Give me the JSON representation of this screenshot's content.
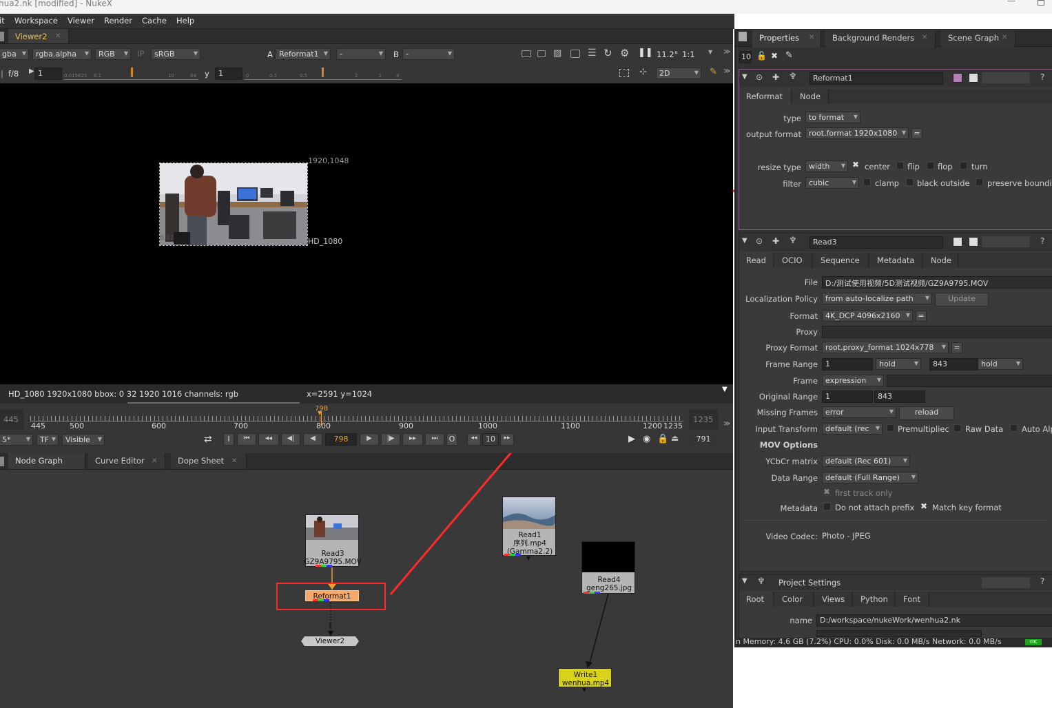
{
  "titlebar": {
    "title": "hua2.nk [modified] - NukeX"
  },
  "menu": {
    "items": [
      "it",
      "Workspace",
      "Viewer",
      "Render",
      "Cache",
      "Help"
    ]
  },
  "viewer": {
    "tab": "Viewer2",
    "channels": "gba",
    "channel_alpha": "rgba.alpha",
    "color": "RGB",
    "ip": "IP",
    "lut": "sRGB",
    "input_a_label": "A",
    "input_a": "Reformat1",
    "input_a2": "-",
    "input_b_label": "B",
    "input_b": "-",
    "zoom": "11.2°",
    "ratio": "1:1",
    "fstop": "f/8",
    "gain": "1",
    "gamma_label": "y",
    "gamma": "1",
    "view_mode": "2D",
    "gain_ticks": [
      "0.015625",
      "0.1",
      "1",
      "10",
      "64"
    ],
    "gamma_ticks": [
      "0",
      "0.1",
      "0.5",
      "1",
      "2",
      "3",
      "4"
    ],
    "image_coord": "1920,1048",
    "format_name": "HD_1080",
    "bottom_left_coord": "0,32",
    "info": "HD_1080 1920x1080  bbox: 0 32 1920 1016 channels: rgb",
    "coords": "x=2591 y=1024"
  },
  "timeline": {
    "start": "445",
    "end": "1235",
    "current": "798",
    "ticks": [
      "445",
      "500",
      "600",
      "700",
      "800",
      "900",
      "1000",
      "1100",
      "1200",
      "1235"
    ],
    "fps": "5*",
    "tf": "TF",
    "visible": "Visible",
    "frame_field": "798",
    "step": "10",
    "end_field": "791",
    "in_label": "I",
    "out_label": "O"
  },
  "nodegraph": {
    "tabs": [
      "Node Graph",
      "Curve Editor",
      "Dope Sheet"
    ],
    "nodes": {
      "read3": {
        "name": "Read3",
        "file": "GZ9A9795.MOV"
      },
      "reformat": {
        "name": "Reformat1"
      },
      "viewer": {
        "name": "Viewer2"
      },
      "read1": {
        "name": "Read1",
        "file": "序列.mp4",
        "extra": "(Gamma2.2)"
      },
      "read4": {
        "name": "Read4",
        "file": "geng265.jpg"
      },
      "write1": {
        "name": "Write1",
        "file": "wenhua.mp4"
      }
    },
    "edge_label": "1"
  },
  "props": {
    "tabs": [
      "Properties",
      "Background Renders",
      "Scene Graph"
    ],
    "max_panels": "10",
    "reformat": {
      "name": "Reformat1",
      "tabs": [
        "Reformat",
        "Node"
      ],
      "type_label": "type",
      "type": "to format",
      "output_label": "output format",
      "output": "root.format 1920x1080",
      "eq": "=",
      "resize_label": "resize type",
      "resize": "width",
      "center": "center",
      "flip": "flip",
      "flop": "flop",
      "turn": "turn",
      "filter_label": "filter",
      "filter": "cubic",
      "clamp": "clamp",
      "black_outside": "black outside",
      "preserve": "preserve boundin"
    },
    "read3": {
      "name": "Read3",
      "tabs": [
        "Read",
        "OCIO",
        "Sequence",
        "Metadata",
        "Node"
      ],
      "file_label": "File",
      "file": "D:/测试使用视频/5D测试视频/GZ9A9795.MOV",
      "loc_label": "Localization Policy",
      "loc": "from auto-localize path",
      "update": "Update",
      "format_label": "Format",
      "format": "4K_DCP 4096x2160",
      "proxy_label": "Proxy",
      "proxy_format_label": "Proxy Format",
      "proxy_format": "root.proxy_format 1024x778",
      "frame_range_label": "Frame Range",
      "fr_start": "1",
      "fr_before": "hold",
      "fr_end": "843",
      "fr_after": "hold",
      "frame_label": "Frame",
      "frame": "expression",
      "orig_range_label": "Original Range",
      "or_start": "1",
      "or_end": "843",
      "missing_label": "Missing Frames",
      "missing": "error",
      "reload": "reload",
      "input_tf_label": "Input Transform",
      "input_tf": "default (rec",
      "premult": "Premultipliec",
      "raw": "Raw Data",
      "auto_alpha": "Auto Alp",
      "mov_options": "MOV Options",
      "ycbcr_label": "YCbCr matrix",
      "ycbcr": "default (Rec 601)",
      "data_range_label": "Data Range",
      "data_range": "default (Full Range)",
      "first_track": "first track only",
      "metadata_label": "Metadata",
      "no_prefix": "Do not attach prefix",
      "match_key": "Match key format",
      "codec_label": "Video Codec:",
      "codec": "Photo - JPEG"
    },
    "project": {
      "title": "Project Settings",
      "tabs": [
        "Root",
        "Color",
        "Views",
        "Python",
        "Font"
      ],
      "name_label": "name",
      "name": "D:/workspace/nukeWork/wenhua2.nk"
    }
  },
  "status": {
    "text": "n Memory: 4.6 GB (7.2%) CPU: 0.0% Disk: 0.0 MB/s Network: 0.0 MB/s",
    "ok": "OK"
  },
  "colors": {
    "accent": "#f0c050",
    "annotation": "#ff2a2a",
    "reformat_node": "#f5a86a",
    "write_node": "#d8d21a"
  }
}
